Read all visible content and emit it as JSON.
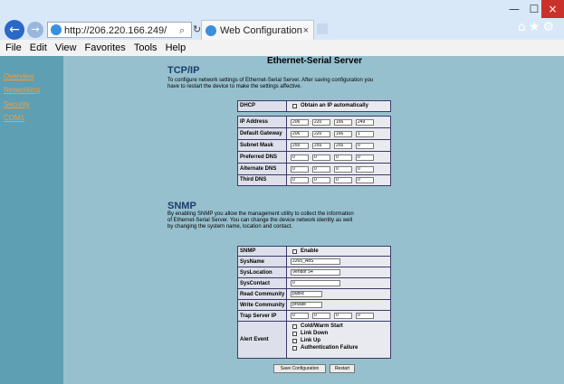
{
  "browser": {
    "url": "http://206.220.166.249/",
    "search_glyph": "⌕ ▾",
    "reload_glyph": "↻",
    "tab_title": "Web Configuration Utility",
    "tab_close": "×",
    "back_glyph": "←",
    "forward_glyph": "→",
    "window_min": "—",
    "window_max": "☐",
    "window_close": "×",
    "toolbar_icons": "⌂★⚙"
  },
  "menu": [
    "File",
    "Edit",
    "View",
    "Favorites",
    "Tools",
    "Help"
  ],
  "sidebar": [
    "Overview",
    "Networking",
    "Security",
    "COM1"
  ],
  "page": {
    "heading": "Ethernet-Serial Server"
  },
  "tcpip": {
    "title": "TCP/IP",
    "description": "To configure network settings of Ethernet-Serial Server. After saving configuration you have to restart the device to make the settings affective.",
    "dhcp_label": "DHCP",
    "dhcp_option": "Obtain an IP automatically",
    "ip_label": "IP Address",
    "ip": [
      "206",
      "220",
      "166",
      "249"
    ],
    "gateway_label": "Default Gateway",
    "gateway": [
      "206",
      "220",
      "166",
      "1"
    ],
    "subnet_label": "Subnet Mask",
    "subnet": [
      "255",
      "255",
      "255",
      "0"
    ],
    "pdns_label": "Preferred DNS",
    "pdns": [
      "0",
      "0",
      "0",
      "0"
    ],
    "adns_label": "Alternate DNS",
    "adns": [
      "0",
      "0",
      "0",
      "0"
    ],
    "tdns_label": "Third DNS",
    "tdns": [
      "0",
      "0",
      "0",
      "0"
    ]
  },
  "snmp": {
    "title": "SNMP",
    "description": "By enabling SNMP you allow the management utility to collect the information of Ethernet-Serial Server. You can change the device network identity as well by changing the system name, location and contact.",
    "snmp_label": "SNMP",
    "enable_label": "Enable",
    "sysname_label": "SysName",
    "sysname": "2265_A8S",
    "syslocation_label": "SysLocation",
    "syslocation": "Vendor 54",
    "syscontact_label": "SysContact",
    "syscontact": "0",
    "read_label": "Read Community",
    "read": "public",
    "write_label": "Write Community",
    "write": "private",
    "trap_label": "Trap Server IP",
    "trap": [
      "0",
      "0",
      "0",
      "0"
    ],
    "alert_label": "Alert Event",
    "alerts": [
      "Cold/Warm Start",
      "Link Down",
      "Link Up",
      "Authentication Failure"
    ]
  },
  "buttons": {
    "save": "Save Configuration",
    "restart": "Restart"
  }
}
